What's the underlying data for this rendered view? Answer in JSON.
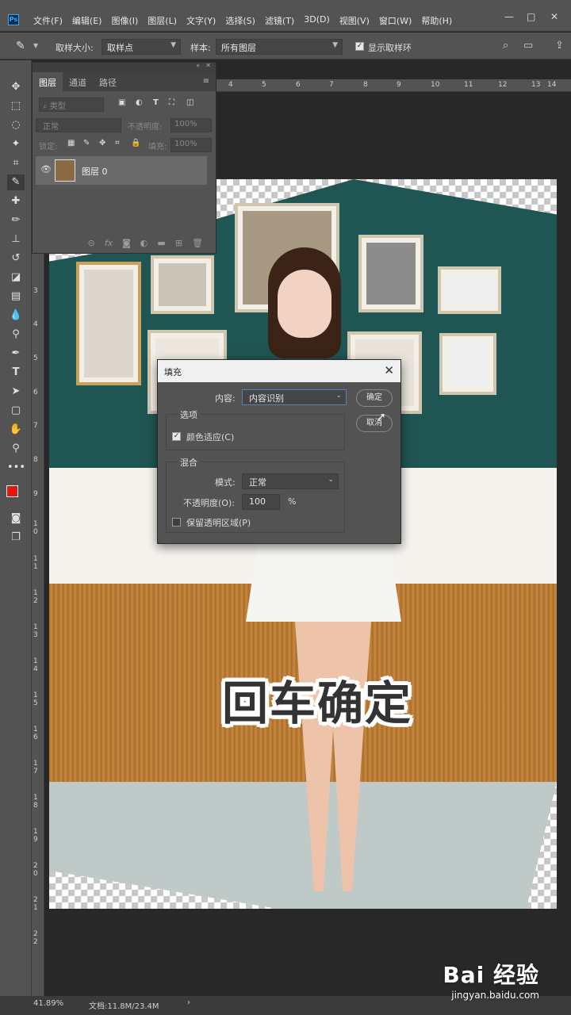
{
  "app": {
    "logo": "Ps"
  },
  "menu": [
    "文件(F)",
    "编辑(E)",
    "图像(I)",
    "图层(L)",
    "文字(Y)",
    "选择(S)",
    "滤镜(T)",
    "3D(D)",
    "视图(V)",
    "窗口(W)",
    "帮助(H)"
  ],
  "window_controls": {
    "minimize": "—",
    "restore": "□",
    "close": "✕"
  },
  "options_bar": {
    "sample_size_label": "取样大小:",
    "sample_size_value": "取样点",
    "sample_label": "样本:",
    "sample_value": "所有图层",
    "show_ring_label": "显示取样环"
  },
  "rulers": {
    "top": [
      "4",
      "5",
      "6",
      "7",
      "8",
      "9",
      "10",
      "11",
      "12",
      "13",
      "14"
    ],
    "left": [
      "3",
      "4",
      "5",
      "6",
      "7",
      "8",
      "9",
      "1 0",
      "1 1",
      "1 2",
      "1 3",
      "1 4",
      "1 5",
      "1 6",
      "1 7",
      "1 8",
      "1 9",
      "2 0",
      "2 1",
      "2 2"
    ]
  },
  "layers_panel": {
    "tabs": [
      "图层",
      "通道",
      "路径"
    ],
    "kind_placeholder": "类型",
    "blend_mode": "正常",
    "opacity_label": "不透明度:",
    "opacity_value": "100%",
    "lock_label": "锁定:",
    "fill_label": "填充:",
    "fill_value": "100%",
    "layer_name": "图层 0"
  },
  "fill_dialog": {
    "title": "填充",
    "close": "✕",
    "contents_label": "内容:",
    "contents_value": "内容识别",
    "ok_button": "确定",
    "cancel_button": "取消",
    "options_title": "选项",
    "color_adaptation_label": "颜色适应(C)",
    "color_adaptation_checked": true,
    "blending_title": "混合",
    "mode_label": "模式:",
    "mode_value": "正常",
    "opacity_label": "不透明度(O):",
    "opacity_value": "100",
    "opacity_unit": "%",
    "preserve_transparency_label": "保留透明区域(P)",
    "preserve_transparency_checked": false
  },
  "overlay_caption": "回车确定",
  "status_bar": {
    "zoom": "41.89%",
    "doc_info": "文档:11.8M/23.4M",
    "arrow": "›"
  },
  "watermark": {
    "brand": "Bai 经验",
    "url": "jingyan.baidu.com"
  },
  "colors": {
    "foreground": "#e3170d",
    "background": "#1a1ad8",
    "ui_bg": "#535353",
    "canvas_bg": "#282828"
  }
}
